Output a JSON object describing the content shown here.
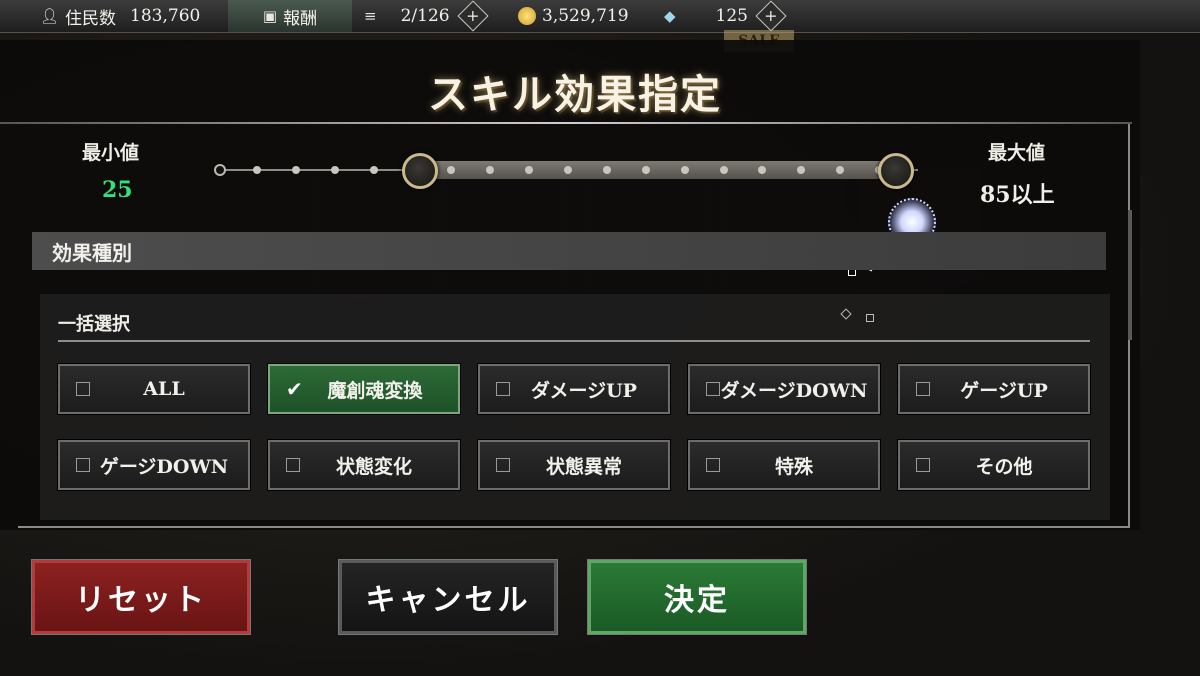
{
  "topbar": {
    "residents_label": "住民数",
    "residents_value": "183,760",
    "reward_label": "報酬",
    "stamina_value": "2/126",
    "coin_value": "3,529,719",
    "gem_value": "125",
    "sale_label": "SALE"
  },
  "dialog": {
    "title": "スキル効果指定",
    "min_label": "最小値",
    "min_value": "25",
    "max_label": "最大値",
    "max_value": "85以上",
    "slider": {
      "min_handle_fraction": 0.29,
      "max_handle_fraction": 0.97,
      "tick_count": 18
    },
    "section_title": "効果種別",
    "bulk_label": "一括選択",
    "options": [
      {
        "label": "ALL",
        "checked": false
      },
      {
        "label": "魔創魂変換",
        "checked": true
      },
      {
        "label": "ダメージUP",
        "checked": false
      },
      {
        "label": "ダメージDOWN",
        "checked": false
      },
      {
        "label": "ゲージUP",
        "checked": false
      },
      {
        "label": "ゲージDOWN",
        "checked": false
      },
      {
        "label": "状態変化",
        "checked": false
      },
      {
        "label": "状態異常",
        "checked": false
      },
      {
        "label": "特殊",
        "checked": false
      },
      {
        "label": "その他",
        "checked": false
      }
    ],
    "buttons": {
      "reset": "リセット",
      "cancel": "キャンセル",
      "confirm": "決定"
    }
  },
  "colors": {
    "checked_bg": "#2d6a37",
    "reset_bg": "#8c2121",
    "confirm_bg": "#2a7a36",
    "min_value_color": "#34e07a"
  },
  "icons": [
    "person-icon",
    "chest-icon",
    "stamina-icon",
    "coin-icon",
    "gem-icon",
    "plus-icon",
    "checkmark-icon"
  ]
}
